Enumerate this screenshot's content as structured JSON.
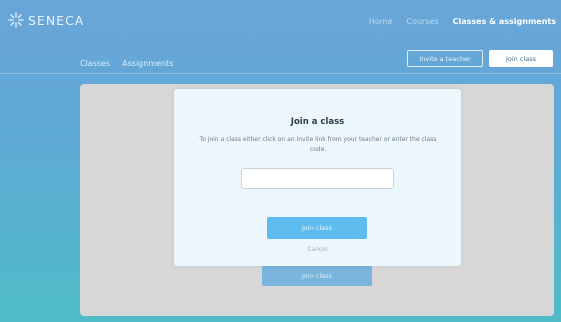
{
  "header": {
    "logo_text": "SENECA",
    "nav": [
      "Home",
      "Courses",
      "Classes & assignments"
    ]
  },
  "subnav": {
    "tabs": [
      "Classes",
      "Assignments"
    ],
    "invite_label": "Invite a teacher",
    "join_label": "Join class"
  },
  "modal": {
    "title": "Join a class",
    "description": "To join a class either click on an invite link from your teacher or enter the class code.",
    "input_value": "",
    "join_button": "Join class",
    "cancel": "Cancel"
  },
  "background": {
    "join_button": "Join class"
  }
}
